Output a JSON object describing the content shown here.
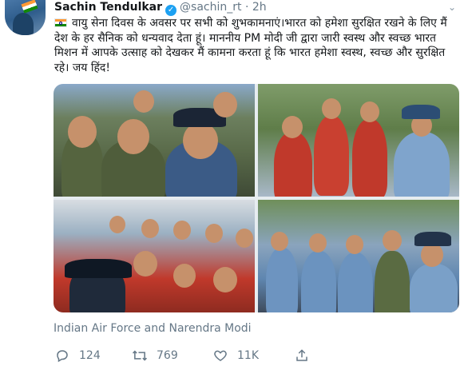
{
  "tweet": {
    "author_name": "Sachin Tendulkar",
    "verified": true,
    "handle": "@sachin_rt",
    "separator": "·",
    "time": "2h",
    "text": "वायु सेना दिवस के अवसर पर सभी को शुभकामनाएं।भारत को हमेशा सुरक्षित रखने के लिए मैं देश के हर सैनिक को धन्यवाद देता हूं। माननीय PM मोदी जी द्वारा जारी स्वस्थ और स्वच्छ भारत मिशन में आपके उत्साह को देखकर मैं कामना करता हूं कि भारत हमेशा स्वस्थ, स्वच्छ और सुरक्षित रहे। जय हिंद!",
    "flag_icon": "india-flag-icon",
    "media_caption": "Indian Air Force and Narendra Modi",
    "photos": [
      {
        "icon": "group-photo-air-force-officers"
      },
      {
        "icon": "handshake-photo-pilots"
      },
      {
        "icon": "group-photo-cadets-red-uniform"
      },
      {
        "icon": "group-photo-officers-blue-uniform"
      }
    ]
  },
  "actions": {
    "reply_count": "124",
    "retweet_count": "769",
    "like_count": "11K",
    "reply_icon": "reply-icon",
    "retweet_icon": "retweet-icon",
    "like_icon": "heart-icon",
    "share_icon": "share-icon"
  },
  "colors": {
    "verified_badge": "#1da1f2",
    "secondary_text": "#657786",
    "primary_text": "#14171a"
  }
}
